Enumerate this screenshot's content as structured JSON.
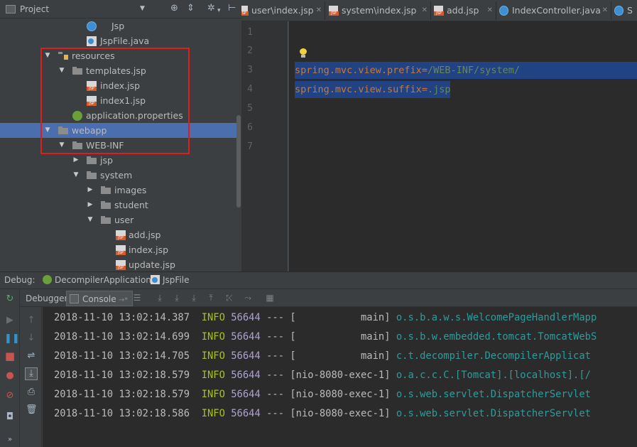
{
  "project_panel": {
    "title": "Project",
    "tree": [
      {
        "label": "Jsp",
        "icon": "class-icon",
        "expanded": null
      },
      {
        "label": "JspFile.java",
        "icon": "java-file-icon",
        "expanded": null
      },
      {
        "label": "resources",
        "icon": "resources-folder-icon",
        "expanded": true
      },
      {
        "label": "templates.jsp",
        "icon": "folder-icon",
        "expanded": true
      },
      {
        "label": "index.jsp",
        "icon": "jsp-file-icon",
        "expanded": null
      },
      {
        "label": "index1.jsp",
        "icon": "jsp-file-icon",
        "expanded": null
      },
      {
        "label": "application.properties",
        "icon": "spring-properties-icon",
        "expanded": null
      },
      {
        "label": "webapp",
        "icon": "folder-icon",
        "expanded": true,
        "selected": true
      },
      {
        "label": "WEB-INF",
        "icon": "folder-icon",
        "expanded": true
      },
      {
        "label": "jsp",
        "icon": "folder-icon",
        "expanded": false
      },
      {
        "label": "system",
        "icon": "folder-icon",
        "expanded": true
      },
      {
        "label": "images",
        "icon": "folder-icon",
        "expanded": false
      },
      {
        "label": "student",
        "icon": "folder-icon",
        "expanded": false
      },
      {
        "label": "user",
        "icon": "folder-icon",
        "expanded": true
      },
      {
        "label": "add.jsp",
        "icon": "jsp-file-icon",
        "expanded": null
      },
      {
        "label": "index.jsp",
        "icon": "jsp-file-icon",
        "expanded": null
      },
      {
        "label": "update.jsp",
        "icon": "jsp-file-icon",
        "expanded": null
      }
    ]
  },
  "editor": {
    "tabs": [
      {
        "label": "user\\index.jsp",
        "icon": "jsp-file-icon"
      },
      {
        "label": "system\\index.jsp",
        "icon": "jsp-file-icon"
      },
      {
        "label": "add.jsp",
        "icon": "jsp-file-icon"
      },
      {
        "label": "IndexController.java",
        "icon": "class-icon"
      },
      {
        "label": "S",
        "icon": "class-icon"
      }
    ],
    "line_numbers": [
      "1",
      "2",
      "3",
      "4",
      "5",
      "6",
      "7"
    ],
    "lines": [
      {
        "key": "spring.mvc.view.prefix",
        "sep": "=",
        "value": "/WEB-INF/system/"
      },
      {
        "key": "spring.mvc.view.suffix",
        "sep": "=",
        "value": ".jsp"
      }
    ]
  },
  "debug": {
    "label": "Debug:",
    "run_tabs": [
      {
        "label": "DecompilerApplication",
        "icon": "spring-boot-icon"
      },
      {
        "label": "JspFile",
        "icon": "java-file-icon"
      }
    ],
    "tabs": {
      "debugger": "Debugger",
      "console": "Console"
    },
    "console_lines": [
      {
        "ts": "2018-11-10 13:02:14.387",
        "level": "INFO",
        "pid": "56644",
        "sep": "---",
        "thread": "[           main]",
        "logger": "o.s.b.a.w.s.WelcomePageHandlerMapp"
      },
      {
        "ts": "2018-11-10 13:02:14.699",
        "level": "INFO",
        "pid": "56644",
        "sep": "---",
        "thread": "[           main]",
        "logger": "o.s.b.w.embedded.tomcat.TomcatWebS"
      },
      {
        "ts": "2018-11-10 13:02:14.705",
        "level": "INFO",
        "pid": "56644",
        "sep": "---",
        "thread": "[           main]",
        "logger": "c.t.decompiler.DecompilerApplicat"
      },
      {
        "ts": "2018-11-10 13:02:18.579",
        "level": "INFO",
        "pid": "56644",
        "sep": "---",
        "thread": "[nio-8080-exec-1]",
        "logger": "o.a.c.c.C.[Tomcat].[localhost].[/"
      },
      {
        "ts": "2018-11-10 13:02:18.579",
        "level": "INFO",
        "pid": "56644",
        "sep": "---",
        "thread": "[nio-8080-exec-1]",
        "logger": "o.s.web.servlet.DispatcherServlet"
      },
      {
        "ts": "2018-11-10 13:02:18.586",
        "level": "INFO",
        "pid": "56644",
        "sep": "---",
        "thread": "[nio-8080-exec-1]",
        "logger": "o.s.web.servlet.DispatcherServlet"
      }
    ]
  },
  "colors": {
    "selection": "#4b6eaf",
    "highlight_box": "#e01d1d",
    "code_selection": "#214283",
    "log_level": "#a8c023",
    "log_pid": "#b0a1d4",
    "log_logger": "#2d9c9c"
  }
}
